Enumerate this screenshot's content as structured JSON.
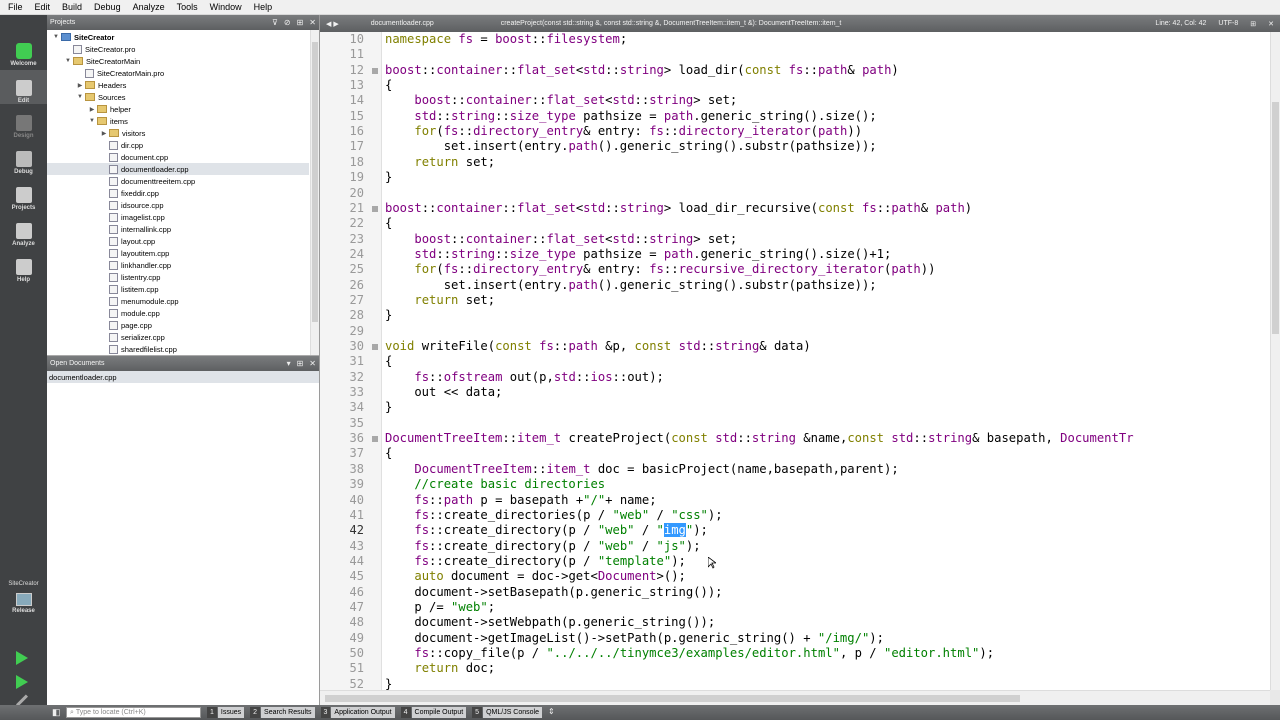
{
  "menu": [
    "File",
    "Edit",
    "Build",
    "Debug",
    "Analyze",
    "Tools",
    "Window",
    "Help"
  ],
  "modes": [
    "Welcome",
    "Edit",
    "Design",
    "Debug",
    "Projects",
    "Analyze",
    "Help"
  ],
  "kit": {
    "project": "SiteCreator",
    "config": "Release"
  },
  "projects_header": "Projects",
  "tree": [
    {
      "label": "SiteCreator",
      "depth": 0,
      "kind": "root",
      "arrow": "▼"
    },
    {
      "label": "SiteCreator.pro",
      "depth": 1,
      "kind": "file",
      "arrow": ""
    },
    {
      "label": "SiteCreatorMain",
      "depth": 1,
      "kind": "folder",
      "arrow": "▼"
    },
    {
      "label": "SiteCreatorMain.pro",
      "depth": 2,
      "kind": "file",
      "arrow": ""
    },
    {
      "label": "Headers",
      "depth": 2,
      "kind": "folder",
      "arrow": "▶"
    },
    {
      "label": "Sources",
      "depth": 2,
      "kind": "folder",
      "arrow": "▼"
    },
    {
      "label": "helper",
      "depth": 3,
      "kind": "folder",
      "arrow": "▶"
    },
    {
      "label": "items",
      "depth": 3,
      "kind": "folder",
      "arrow": "▼"
    },
    {
      "label": "visitors",
      "depth": 4,
      "kind": "folder",
      "arrow": "▶"
    },
    {
      "label": "dir.cpp",
      "depth": 4,
      "kind": "file",
      "arrow": ""
    },
    {
      "label": "document.cpp",
      "depth": 4,
      "kind": "file",
      "arrow": ""
    },
    {
      "label": "documentloader.cpp",
      "depth": 4,
      "kind": "file",
      "arrow": "",
      "selected": true
    },
    {
      "label": "documenttreeitem.cpp",
      "depth": 4,
      "kind": "file",
      "arrow": ""
    },
    {
      "label": "fixeddir.cpp",
      "depth": 4,
      "kind": "file",
      "arrow": ""
    },
    {
      "label": "idsource.cpp",
      "depth": 4,
      "kind": "file",
      "arrow": ""
    },
    {
      "label": "imagelist.cpp",
      "depth": 4,
      "kind": "file",
      "arrow": ""
    },
    {
      "label": "internallink.cpp",
      "depth": 4,
      "kind": "file",
      "arrow": ""
    },
    {
      "label": "layout.cpp",
      "depth": 4,
      "kind": "file",
      "arrow": ""
    },
    {
      "label": "layoutitem.cpp",
      "depth": 4,
      "kind": "file",
      "arrow": ""
    },
    {
      "label": "linkhandler.cpp",
      "depth": 4,
      "kind": "file",
      "arrow": ""
    },
    {
      "label": "listentry.cpp",
      "depth": 4,
      "kind": "file",
      "arrow": ""
    },
    {
      "label": "listitem.cpp",
      "depth": 4,
      "kind": "file",
      "arrow": ""
    },
    {
      "label": "menumodule.cpp",
      "depth": 4,
      "kind": "file",
      "arrow": ""
    },
    {
      "label": "module.cpp",
      "depth": 4,
      "kind": "file",
      "arrow": ""
    },
    {
      "label": "page.cpp",
      "depth": 4,
      "kind": "file",
      "arrow": ""
    },
    {
      "label": "serializer.cpp",
      "depth": 4,
      "kind": "file",
      "arrow": ""
    },
    {
      "label": "sharedfilelist.cpp",
      "depth": 4,
      "kind": "file",
      "arrow": ""
    }
  ],
  "open_docs_header": "Open Documents",
  "open_docs": [
    "documentloader.cpp"
  ],
  "editor_bar": {
    "file": "documentloader.cpp",
    "function": "createProject(const std::string &, const std::string &, DocumentTreeItem::item_t &): DocumentTreeItem::item_t",
    "position": "Line: 42, Col: 42",
    "encoding": "UTF-8"
  },
  "first_line": 10,
  "current_line": 42,
  "code": [
    "namespace fs = boost::filesystem;",
    "",
    "boost::container::flat_set<std::string> load_dir(const fs::path& path)",
    "{",
    "    boost::container::flat_set<std::string> set;",
    "    std::string::size_type pathsize = path.generic_string().size();",
    "    for(fs::directory_entry& entry: fs::directory_iterator(path))",
    "        set.insert(entry.path().generic_string().substr(pathsize));",
    "    return set;",
    "}",
    "",
    "boost::container::flat_set<std::string> load_dir_recursive(const fs::path& path)",
    "{",
    "    boost::container::flat_set<std::string> set;",
    "    std::string::size_type pathsize = path.generic_string().size()+1;",
    "    for(fs::directory_entry& entry: fs::recursive_directory_iterator(path))",
    "        set.insert(entry.path().generic_string().substr(pathsize));",
    "    return set;",
    "}",
    "",
    "void writeFile(const fs::path &p, const std::string& data)",
    "{",
    "    fs::ofstream out(p,std::ios::out);",
    "    out << data;",
    "}",
    "",
    "DocumentTreeItem::item_t createProject(const std::string &name,const std::string& basepath, DocumentTr",
    "{",
    "    DocumentTreeItem::item_t doc = basicProject(name,basepath,parent);",
    "    //create basic directories",
    "    fs::path p = basepath +\"/\"+ name;",
    "    fs::create_directories(p / \"web\" / \"css\");",
    "    fs::create_directory(p / \"web\" / \"img\");",
    "    fs::create_directory(p / \"web\" / \"js\");",
    "    fs::create_directory(p / \"template\");",
    "    auto document = doc->get<Document>();",
    "    document->setBasepath(p.generic_string());",
    "    p /= \"web\";",
    "    document->setWebpath(p.generic_string());",
    "    document->getImageList()->setPath(p.generic_string() + \"/img/\");",
    "    fs::copy_file(p / \"../../../tinymce3/examples/editor.html\", p / \"editor.html\");",
    "    return doc;",
    "}"
  ],
  "locate_placeholder": "Type to locate (Ctrl+K)",
  "output_panes": [
    {
      "n": "1",
      "label": "Issues"
    },
    {
      "n": "2",
      "label": "Search Results"
    },
    {
      "n": "3",
      "label": "Application Output"
    },
    {
      "n": "4",
      "label": "Compile Output"
    },
    {
      "n": "5",
      "label": "QML/JS Console"
    }
  ]
}
